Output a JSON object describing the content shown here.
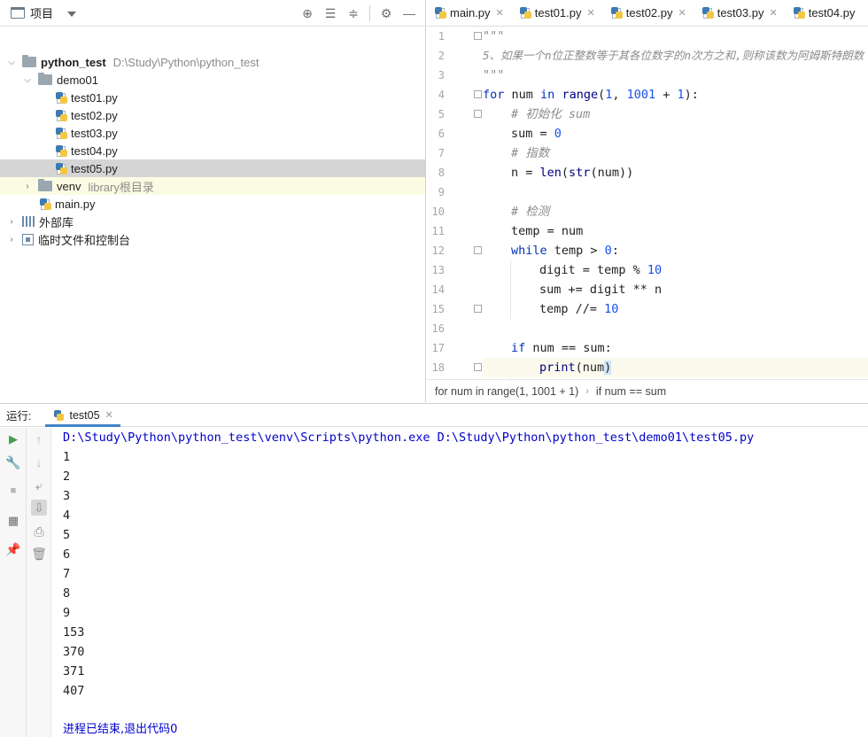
{
  "project": {
    "title": "项目",
    "tree": [
      {
        "label": "python_test",
        "path": "D:\\Study\\Python\\python_test"
      },
      {
        "label": "demo01"
      },
      {
        "label": "test01.py"
      },
      {
        "label": "test02.py"
      },
      {
        "label": "test03.py"
      },
      {
        "label": "test04.py"
      },
      {
        "label": "test05.py"
      },
      {
        "label": "venv",
        "note": "library根目录"
      },
      {
        "label": "main.py"
      },
      {
        "label": "外部库"
      },
      {
        "label": "临时文件和控制台"
      }
    ]
  },
  "editor": {
    "tabs": [
      {
        "label": "main.py"
      },
      {
        "label": "test01.py"
      },
      {
        "label": "test02.py"
      },
      {
        "label": "test03.py"
      },
      {
        "label": "test04.py"
      }
    ],
    "lines": {
      "l1": "\"\"\"",
      "l2": "5、如果一个n位正整数等于其各位数字的n次方之和,则称该数为阿姆斯特朗数",
      "l3": "\"\"\"",
      "l5": "# 初始化 sum",
      "l7": "# 指数",
      "l10": "# 检测"
    },
    "line_numbers": [
      "1",
      "2",
      "3",
      "4",
      "5",
      "6",
      "7",
      "8",
      "9",
      "10",
      "11",
      "12",
      "13",
      "14",
      "15",
      "16",
      "17",
      "18"
    ],
    "breadcrumb": [
      "for num in range(1, 1001 + 1)",
      "if num == sum"
    ]
  },
  "run": {
    "label": "运行:",
    "tab": "test05",
    "command": "D:\\Study\\Python\\python_test\\venv\\Scripts\\python.exe D:\\Study\\Python\\python_test\\demo01\\test05.py",
    "output": [
      "1",
      "2",
      "3",
      "4",
      "5",
      "6",
      "7",
      "8",
      "9",
      "153",
      "370",
      "371",
      "407"
    ],
    "exit_message": "进程已结束,退出代码0"
  },
  "colors": {
    "keyword": "#0033b3",
    "number": "#1750eb",
    "comment": "#8c8c8c",
    "accent": "#4083c9",
    "selection": "#d5d5d5"
  }
}
